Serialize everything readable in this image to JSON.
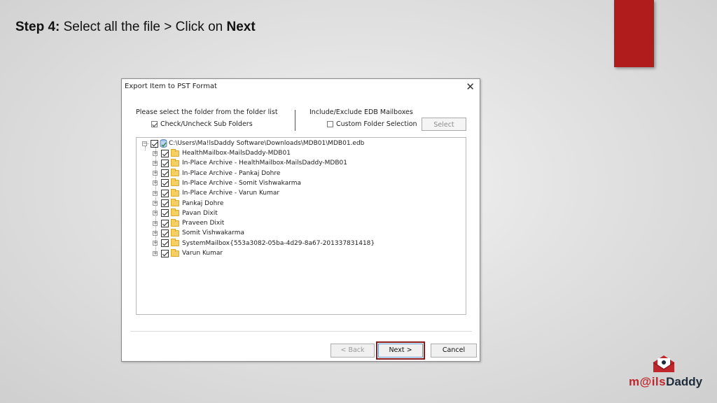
{
  "slide": {
    "step_label": "Step 4:",
    "instruction": " Select all the file > Click on ",
    "instruction_bold": "Next"
  },
  "brand": {
    "prefix": "m@ils",
    "suffix": "Daddy",
    "accent_color": "#c0272d"
  },
  "dialog": {
    "title": "Export Item to PST Format",
    "close_glyph": "✕",
    "folder_prompt": "Please select the folder from the folder list",
    "check_sub_folders": {
      "label": "Check/Uncheck Sub Folders",
      "checked": true
    },
    "include_exclude_label": "Include/Exclude EDB Mailboxes",
    "custom_folder": {
      "label": "Custom Folder Selection",
      "checked": false
    },
    "select_button": "Select",
    "tree": {
      "root": "C:\\Users\\Ma!lsDaddy Software\\Downloads\\MDB01\\MDB01.edb",
      "items": [
        "HealthMailbox-MailsDaddy-MDB01",
        "In-Place Archive - HealthMailbox-MailsDaddy-MDB01",
        "In-Place Archive - Pankaj Dohre",
        "In-Place Archive - Somit Vishwakarma",
        "In-Place Archive - Varun Kumar",
        "Pankaj Dohre",
        "Pavan Dixit",
        "Praveen Dixit",
        "Somit Vishwakarma",
        "SystemMailbox{553a3082-05ba-4d29-8a67-201337831418}",
        "Varun Kumar"
      ]
    },
    "buttons": {
      "back": "< Back",
      "next": "Next >",
      "cancel": "Cancel"
    }
  }
}
